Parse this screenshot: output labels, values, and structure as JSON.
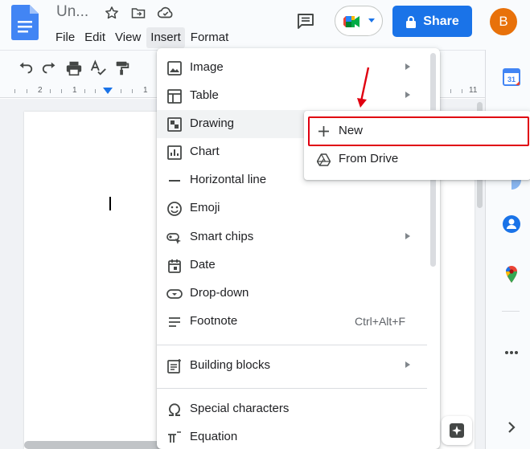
{
  "header": {
    "doc_title": "Un...",
    "menus": [
      "File",
      "Edit",
      "View",
      "Insert",
      "Format"
    ],
    "share_label": "Share",
    "avatar_initial": "B"
  },
  "ruler": {
    "numbers": [
      "2",
      "1",
      "1",
      "11"
    ]
  },
  "insert_menu": {
    "items": [
      {
        "label": "Image",
        "icon": "image-icon",
        "submenu": true
      },
      {
        "label": "Table",
        "icon": "table-icon",
        "submenu": true
      },
      {
        "label": "Drawing",
        "icon": "drawing-icon",
        "submenu": true,
        "hover": true
      },
      {
        "label": "Chart",
        "icon": "chart-icon",
        "submenu": true
      },
      {
        "label": "Horizontal line",
        "icon": "horizontal-line-icon"
      },
      {
        "label": "Emoji",
        "icon": "emoji-icon"
      },
      {
        "label": "Smart chips",
        "icon": "smart-chips-icon",
        "submenu": true
      },
      {
        "label": "Date",
        "icon": "date-icon"
      },
      {
        "label": "Drop-down",
        "icon": "dropdown-icon"
      },
      {
        "label": "Footnote",
        "icon": "footnote-icon",
        "shortcut": "Ctrl+Alt+F"
      },
      {
        "label": "Building blocks",
        "icon": "building-blocks-icon",
        "submenu": true
      },
      {
        "label": "Special characters",
        "icon": "omega-icon"
      },
      {
        "label": "Equation",
        "icon": "equation-icon"
      }
    ]
  },
  "drawing_submenu": {
    "items": [
      {
        "label": "New",
        "icon": "plus-icon"
      },
      {
        "label": "From Drive",
        "icon": "drive-icon"
      }
    ]
  },
  "colors": {
    "share": "#1a73e8",
    "avatar": "#e8710a",
    "highlight": "#e00010",
    "doc_blue": "#4285f4"
  }
}
